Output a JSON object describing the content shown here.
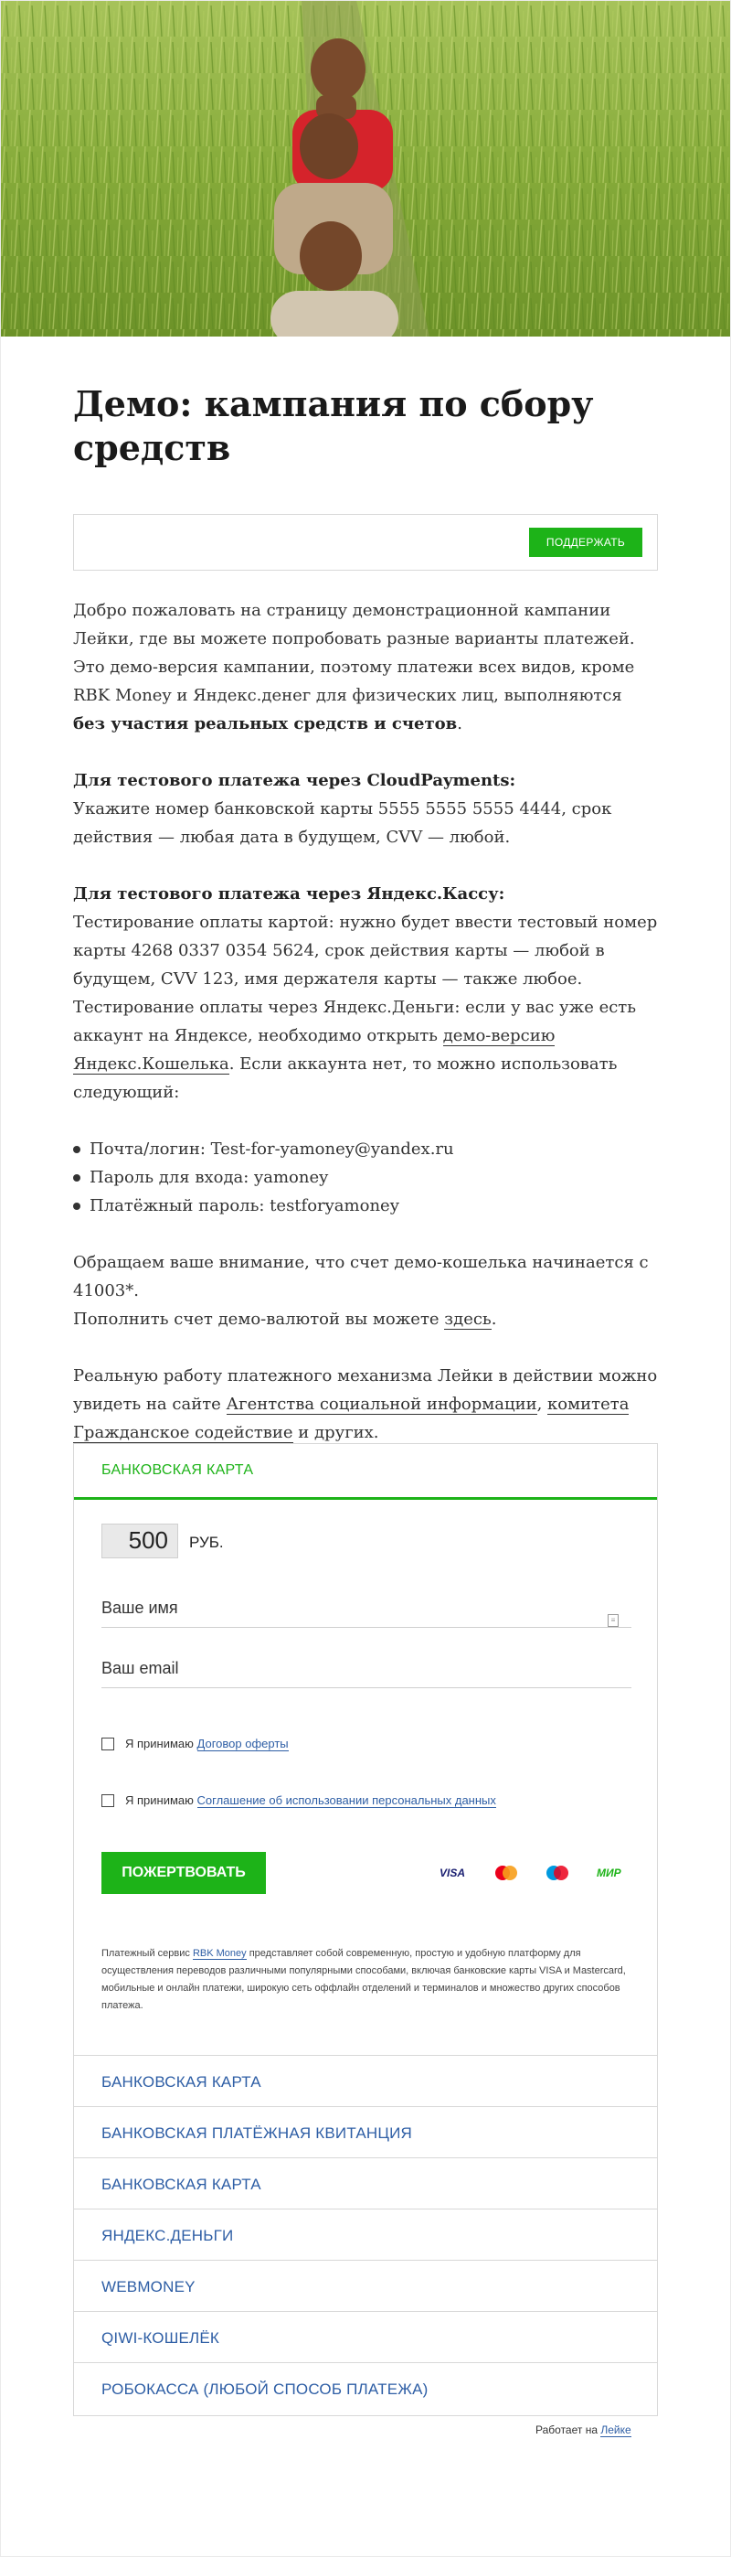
{
  "hero": {
    "alt": ""
  },
  "page": {
    "title": "Демо: кампания по сбору средств",
    "support_button": "ПОДДЕРЖАТЬ"
  },
  "content": {
    "intro_1": "Добро пожаловать на страницу демонстрационной кампании Лейки, где вы можете попробовать разные варианты платежей. Это демо-версия кампании, поэтому платежи всех видов, кроме RBK Money и Яндекс.денег для физических лиц, выполняются ",
    "intro_bold": "без участия реальных средств и счетов",
    "intro_end": ".",
    "cp_heading": "Для тестового платежа через CloudPayments:",
    "cp_text": "Укажите номер банковской карты 5555 5555 5555 4444, срок действия — любая дата в будущем, CVV — любой.",
    "yk_heading": "Для тестового платежа через Яндекс.Кассу:",
    "yk_text_1": "Тестирование оплаты картой: нужно будет ввести тестовый номер карты 4268 0337 0354 5624, срок действия карты — любой в будущем, CVV 123, имя держателя карты — также любое.",
    "yk_text_2": "Тестирование оплаты через Яндекс.Деньги: если у вас уже есть аккаунт на Яндексе, необходимо открыть ",
    "yk_link": "демо-версию Яндекс.Кошелька",
    "yk_text_3": ". Если аккаунта нет, то можно использовать следующий:",
    "list": [
      "Почта/логин: Test-for-yamoney@yandex.ru",
      "Пароль для входа: yamoney",
      "Платёжный пароль: testforyamoney"
    ],
    "wallet_note_1": "Обращаем ваше внимание, что счет демо-кошелька начинается с 41003*.",
    "wallet_note_2": "Пополнить счет демо-валютой вы можете ",
    "wallet_link": "здесь",
    "wallet_end": ".",
    "real_1": "Реальную работу платежного механизма Лейки в действии можно увидеть на сайте ",
    "real_link_1": "Агентства социальной информации",
    "real_sep": ", ",
    "real_link_2": "комитета Гражданское содействие",
    "real_end": " и других."
  },
  "form": {
    "active_tab": "БАНКОВСКАЯ КАРТА",
    "amount": "500",
    "currency": "РУБ.",
    "name_placeholder": "Ваше имя",
    "email_placeholder": "Ваш email",
    "agree_prefix": "Я принимаю",
    "offer_link": "Договор оферты",
    "pd_link": "Соглашение об использовании персональных данных",
    "donate_button": "ПОЖЕРТВОВАТЬ",
    "card_visa": "VISA",
    "card_mir": "МИР",
    "fine_1": "Платежный сервис ",
    "fine_link": "RBK Money",
    "fine_2": " представляет собой современную, простую и удобную платформу для осуществления переводов различными популярными способами, включая банковские карты VISA и Mastercard, мобильные и онлайн платежи, широкую сеть оффлайн отделений и терминалов и множество других способов платежа."
  },
  "methods": [
    "БАНКОВСКАЯ КАРТА",
    "БАНКОВСКАЯ ПЛАТЁЖНАЯ КВИТАНЦИЯ",
    "БАНКОВСКАЯ КАРТА",
    "ЯНДЕКС.ДЕНЬГИ",
    "WEBMONEY",
    "QIWI-КОШЕЛЁК",
    "РОБОКАССА (ЛЮБОЙ СПОСОБ ПЛАТЕЖА)"
  ],
  "footer": {
    "powered_prefix": "Работает на ",
    "powered_link": "Лейке"
  },
  "colors": {
    "accent": "#1db318",
    "link": "#2e5ea5",
    "text": "#333333"
  }
}
